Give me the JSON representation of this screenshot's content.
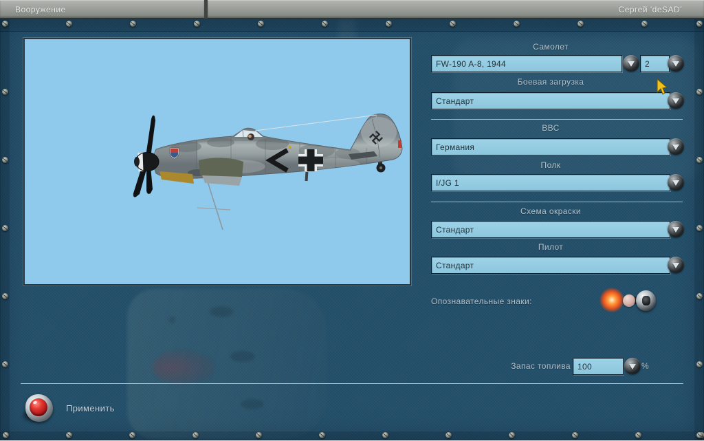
{
  "titlebar": {
    "screen_tab": "Вооружение",
    "player_name": "Сергей 'deSAD'"
  },
  "form": {
    "aircraft": {
      "label": "Самолет",
      "value": "FW-190 A-8, 1944",
      "count": "2"
    },
    "loadout": {
      "label": "Боевая загрузка",
      "value": "Стандарт"
    },
    "airforce": {
      "label": "ВВС",
      "value": "Германия"
    },
    "regiment": {
      "label": "Полк",
      "value": "I/JG 1"
    },
    "paint_scheme": {
      "label": "Схема окраски",
      "value": "Стандарт"
    },
    "pilot": {
      "label": "Пилот",
      "value": "Стандарт"
    },
    "markings_label": "Опознавательные знаки:",
    "fuel": {
      "label": "Запас топлива",
      "value": "100",
      "unit": "%"
    }
  },
  "apply_label": "Применить",
  "preview": {
    "subject": "FW-190 A-8 side view on light blue background"
  },
  "colors": {
    "panel_teal": "#24506b",
    "field_blue": "#93cbe2",
    "preview_sky": "#8fc9ec",
    "titlebar_gray": "#989c97",
    "indicator_orange": "#ff8830",
    "apply_red": "#cc2020",
    "label_text": "#b2c2cb"
  }
}
